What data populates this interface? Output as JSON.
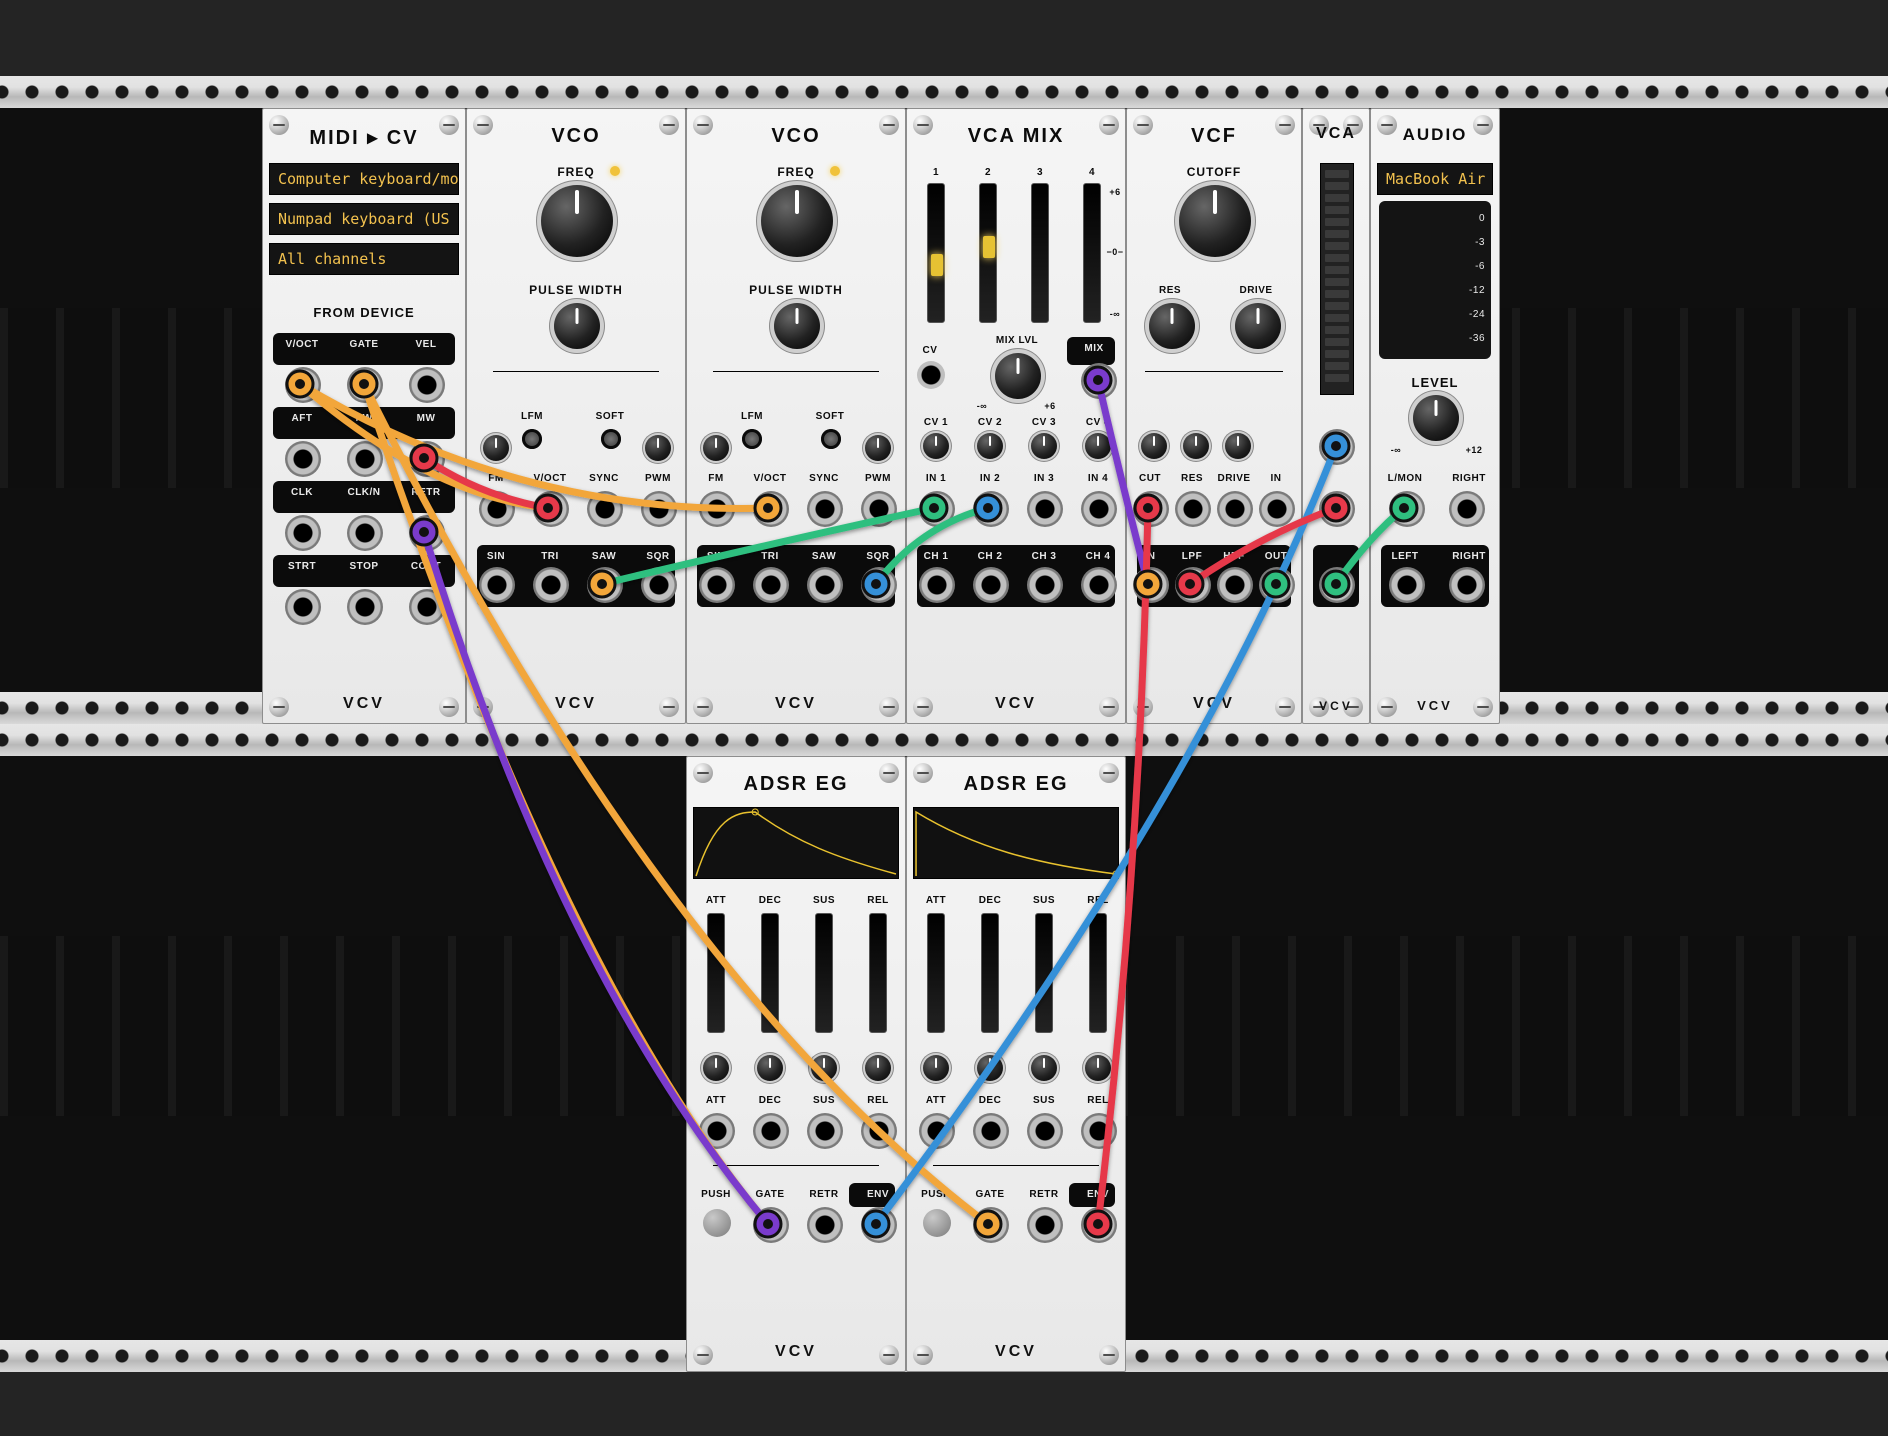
{
  "brand": "VCV",
  "midi_cv": {
    "title": "MIDI ▸ CV",
    "rows": [
      "Computer keyboard/mo",
      "Numpad keyboard (US",
      "All channels"
    ],
    "section": "FROM DEVICE",
    "jacks": [
      "V/OCT",
      "GATE",
      "VEL",
      "AFT",
      "PW",
      "MW",
      "CLK",
      "CLK/N",
      "RETR",
      "STRT",
      "STOP",
      "CONT"
    ]
  },
  "vco": {
    "title": "VCO",
    "freq": "FREQ",
    "pulse": "PULSE WIDTH",
    "switches": [
      "LFM",
      "SOFT"
    ],
    "small_knobs": "",
    "cv_in": [
      "FM",
      "V/OCT",
      "SYNC",
      "PWM"
    ],
    "waves": [
      "SIN",
      "TRI",
      "SAW",
      "SQR"
    ]
  },
  "vco2": {
    "title": "VCO",
    "freq": "FREQ",
    "pulse": "PULSE WIDTH",
    "switches": [
      "LFM",
      "SOFT"
    ],
    "cv_in": [
      "FM",
      "V/OCT",
      "SYNC",
      "PWM"
    ],
    "waves": [
      "SIN",
      "TRI",
      "SAW",
      "SQR"
    ]
  },
  "vcamix": {
    "title": "VCA MIX",
    "ch_nums": [
      "1",
      "2",
      "3",
      "4"
    ],
    "scale": [
      "+6",
      "−0−",
      "-∞"
    ],
    "mix_row": {
      "cv": "CV",
      "label": "MIX LVL",
      "mix": "MIX",
      "range_l": "-∞",
      "range_r": "+6"
    },
    "cv_row": [
      "CV 1",
      "CV 2",
      "CV 3",
      "CV 4"
    ],
    "in_row": [
      "IN 1",
      "IN 2",
      "IN 3",
      "IN 4"
    ],
    "out_row": [
      "CH 1",
      "CH 2",
      "CH 3",
      "CH 4"
    ]
  },
  "vcf": {
    "title": "VCF",
    "cutoff": "CUTOFF",
    "res": "RES",
    "drive": "DRIVE",
    "cv_in": [
      "CUT",
      "RES",
      "DRIVE",
      "IN"
    ],
    "out": [
      "IN",
      "LPF",
      "HPF",
      "OUT"
    ]
  },
  "vca": {
    "title": "VCA"
  },
  "audio": {
    "title": "AUDIO",
    "device": "MacBook Air",
    "db_marks": [
      "0",
      "-3",
      "-6",
      "-12",
      "-24",
      "-36"
    ],
    "level": "LEVEL",
    "level_range_l": "-∞",
    "level_range_r": "+12",
    "io_top": [
      "L/MON",
      "RIGHT"
    ],
    "io_bot": [
      "LEFT",
      "RIGHT"
    ]
  },
  "adsr1": {
    "title": "ADSR EG",
    "params": [
      "ATT",
      "DEC",
      "SUS",
      "REL"
    ],
    "bottom": [
      "PUSH",
      "GATE",
      "RETR",
      "ENV"
    ]
  },
  "adsr2": {
    "title": "ADSR EG",
    "params": [
      "ATT",
      "DEC",
      "SUS",
      "REL"
    ],
    "bottom": [
      "PUSH",
      "GATE",
      "RETR",
      "ENV"
    ]
  },
  "cable_colors": {
    "orange": "#f2a63a",
    "red": "#e6394a",
    "green": "#2fbf7f",
    "blue": "#3590d8",
    "purple": "#7a3bcc",
    "yellow": "#e9c22e"
  }
}
